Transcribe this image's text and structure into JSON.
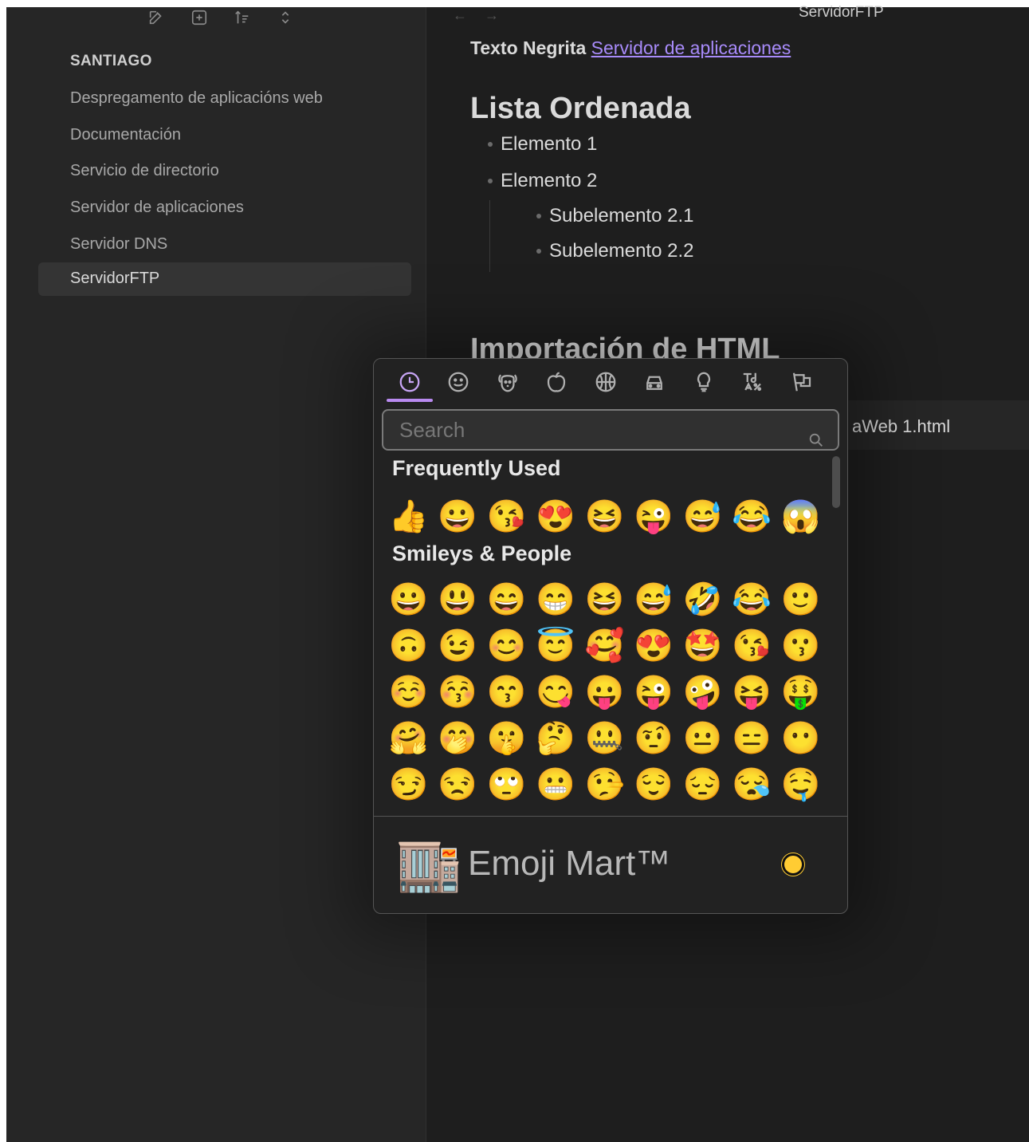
{
  "sidebar": {
    "toolbar": [
      {
        "name": "new-note-icon"
      },
      {
        "name": "new-folder-icon"
      },
      {
        "name": "sort-icon"
      },
      {
        "name": "collapse-icon"
      }
    ],
    "vault_name": "SANTIAGO",
    "files": [
      {
        "label": "Despregamento de aplicacións web",
        "active": false
      },
      {
        "label": "Documentación",
        "active": false
      },
      {
        "label": "Servicio de directorio",
        "active": false
      },
      {
        "label": "Servidor de aplicaciones",
        "active": false
      },
      {
        "label": "Servidor DNS",
        "active": false
      },
      {
        "label": "ServidorFTP",
        "active": true
      }
    ]
  },
  "main": {
    "nav": {
      "back": "←",
      "forward": "→"
    },
    "doc_title": "ServidorFTP",
    "bold_text": "Texto Negrita",
    "link_text": "Servidor de aplicaciones",
    "heading_list": "Lista Ordenada",
    "items": [
      "Elemento 1",
      "Elemento 2"
    ],
    "subitems": [
      "Subelemento 2.1",
      "Subelemento 2.2"
    ],
    "heading_import": "Importación de HTML",
    "embed_text": "aWeb 1.html"
  },
  "emoji_picker": {
    "categories": [
      {
        "name": "recent-icon",
        "active": true
      },
      {
        "name": "smiley-icon",
        "active": false
      },
      {
        "name": "animal-icon",
        "active": false
      },
      {
        "name": "food-icon",
        "active": false
      },
      {
        "name": "activity-icon",
        "active": false
      },
      {
        "name": "travel-icon",
        "active": false
      },
      {
        "name": "objects-icon",
        "active": false
      },
      {
        "name": "symbols-icon",
        "active": false
      },
      {
        "name": "flags-icon",
        "active": false
      }
    ],
    "search_placeholder": "Search",
    "frequently_used_label": "Frequently Used",
    "frequently_used": [
      "👍",
      "😀",
      "😘",
      "😍",
      "😆",
      "😜",
      "😅",
      "😂",
      "😱"
    ],
    "smileys_label": "Smileys & People",
    "smileys": [
      [
        "😀",
        "😃",
        "😄",
        "😁",
        "😆",
        "😅",
        "🤣",
        "😂",
        "🙂"
      ],
      [
        "🙃",
        "😉",
        "😊",
        "😇",
        "🥰",
        "😍",
        "🤩",
        "😘",
        "😗"
      ],
      [
        "☺️",
        "😚",
        "😙",
        "😋",
        "😛",
        "😜",
        "🤪",
        "😝",
        "🤑"
      ],
      [
        "🤗",
        "🤭",
        "🤫",
        "🤔",
        "🤐",
        "🤨",
        "😐",
        "😑",
        "😶"
      ],
      [
        "😏",
        "😒",
        "🙄",
        "😬",
        "🤥",
        "😌",
        "😔",
        "😪",
        "🤤"
      ]
    ],
    "footer_logo": "🏬",
    "footer_title": "Emoji Mart™",
    "skin_tone_color": "#ffcc33"
  }
}
